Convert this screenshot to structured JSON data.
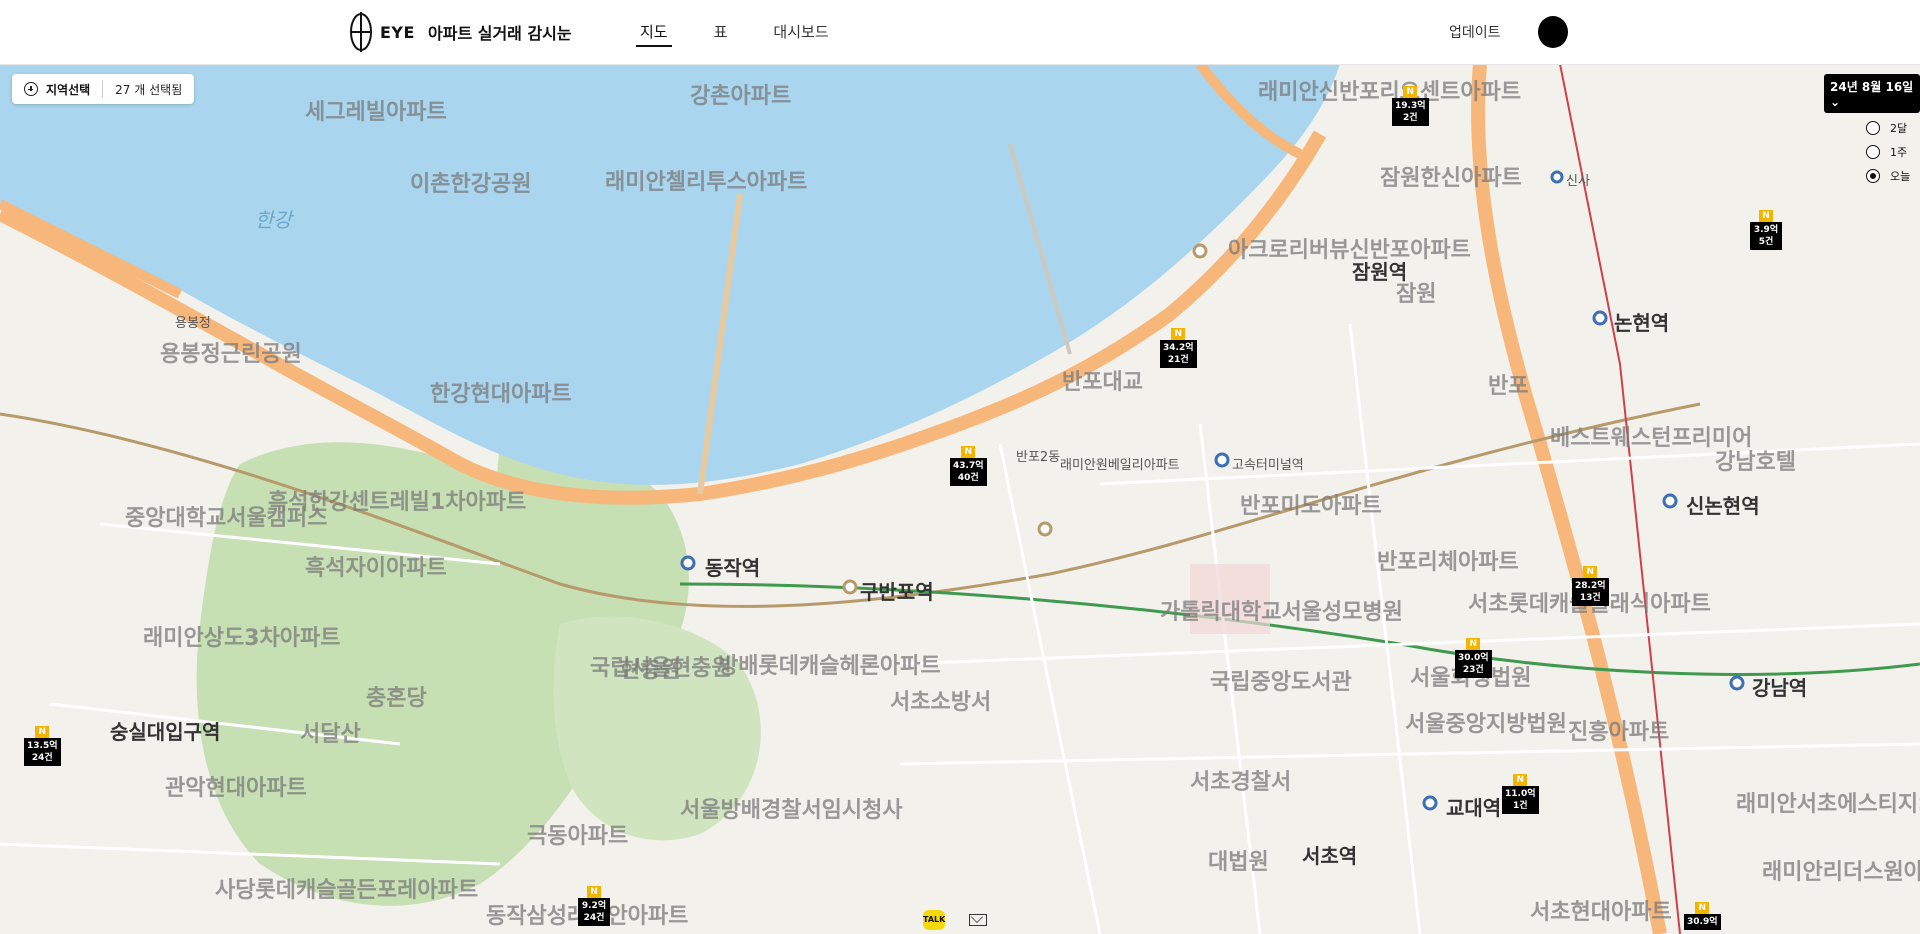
{
  "header": {
    "logo_text": "EYE",
    "app_title": "아파트 실거래 감시눈",
    "nav": {
      "map": "지도",
      "table": "표",
      "dashboard": "대시보드"
    },
    "update": "업데이트"
  },
  "region": {
    "select_label": "지역선택",
    "count_label": "27 개 선택됨"
  },
  "date_badge": "24년 8월 16일 ⌄",
  "period_options": [
    "2달",
    "1주",
    "오늘"
  ],
  "period_selected": "오늘",
  "map_labels": {
    "big": [
      "세그레빌아파트",
      "강촌아파트",
      "이촌한강공원",
      "래미안첼리투스아파트",
      "한강현대아파트",
      "흑석한강센트레빌1차아파트",
      "흑석자이아파트",
      "래미안상도3차아파트",
      "중앙대학교서울캠퍼스",
      "현충원",
      "동작역",
      "구반포역",
      "국립서울현충원",
      "방배롯데캐슬헤론아파트",
      "서초소방서",
      "국립중앙도서관",
      "서울회생법원",
      "서울중앙지방법원",
      "서초경찰서",
      "대법원",
      "서초역",
      "교대역",
      "강남역",
      "신논현역",
      "논현역",
      "신사",
      "반포대교",
      "반포2동",
      "래미안원베일리아파트",
      "아크로리버뷰신반포아파트",
      "잠원역",
      "잠원한신아파트",
      "래미안신반포리오센트아파트",
      "반포리체아파트",
      "서초롯데캐슬클래식아파트",
      "진흥아파트",
      "래미안서초에스티지S아파트",
      "래미안리더스원아파트",
      "서초현대아파트",
      "베스트웨스턴프리미어",
      "강남호텔",
      "극동아파트",
      "서울방배경찰서임시청사",
      "서달산",
      "충혼당",
      "숭실대입구역",
      "관악현대아파트",
      "사당롯데캐슬골든포레아파트",
      "동작삼성래미안아파트",
      "잠원",
      "반포",
      "고속터미널역",
      "반포미도아파트",
      "가톨릭대학교서울성모병원",
      "한강",
      "용봉정",
      "용봉정근린공원"
    ],
    "river": [
      "한강"
    ],
    "marker_labels": []
  },
  "markers": [
    {
      "price": "19.3억",
      "count": "2건"
    },
    {
      "price": "34.2억",
      "count": "21건"
    },
    {
      "price": "43.7억",
      "count": "40건"
    },
    {
      "price": "3.9억",
      "count": "5건"
    },
    {
      "price": "28.2억",
      "count": "13건"
    },
    {
      "price": "30.0억",
      "count": "23건"
    },
    {
      "price": "13.5억",
      "count": "24건"
    },
    {
      "price": "11.0억",
      "count": "1건"
    },
    {
      "price": "9.2억",
      "count": "24건"
    },
    {
      "price": "30.9억",
      "count": ""
    }
  ],
  "chat_icon_label": "TALK",
  "colors": {
    "river": "#a9d6ee",
    "expressway": "#f7b77a",
    "park": "#bcd9a8",
    "marker_n": "#f5b400"
  }
}
